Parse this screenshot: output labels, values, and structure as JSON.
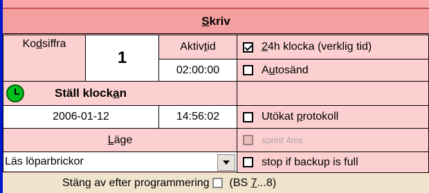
{
  "header": {
    "title_pre": "",
    "title_u": "S",
    "title_post": "kriv"
  },
  "code": {
    "label_pre": "Ko",
    "label_u": "d",
    "label_post": "siffra",
    "value": "1"
  },
  "active_time": {
    "label_pre": "Aktiv ",
    "label_u": "t",
    "label_post": "id",
    "value": "02:00:00"
  },
  "clock": {
    "label_pre": "Ställ klock",
    "label_u": "a",
    "label_post": "n",
    "date": "2006-01-12",
    "time": "14:56:02"
  },
  "mode": {
    "label_pre": "",
    "label_u": "L",
    "label_post": "äge",
    "selected": "Läs löparbrickor"
  },
  "options": {
    "h24": {
      "label_pre": "",
      "label_u": "2",
      "label_post": "4h klocka (verklig tid)",
      "checked": true
    },
    "autosend": {
      "label_pre": "A",
      "label_u": "u",
      "label_post": "tosänd",
      "checked": false
    },
    "extended": {
      "label_pre": "Utökat ",
      "label_u": "p",
      "label_post": "rotokoll",
      "checked": false
    },
    "sprint": {
      "label": "sprint 4ms",
      "checked": false
    },
    "stop_backup": {
      "label": "stop if backup is full",
      "checked": false
    }
  },
  "turn_off": {
    "label": "Stäng av efter programmering",
    "checked": false
  },
  "bs": {
    "pre": "(BS ",
    "u": "7",
    "post": "...8)"
  }
}
